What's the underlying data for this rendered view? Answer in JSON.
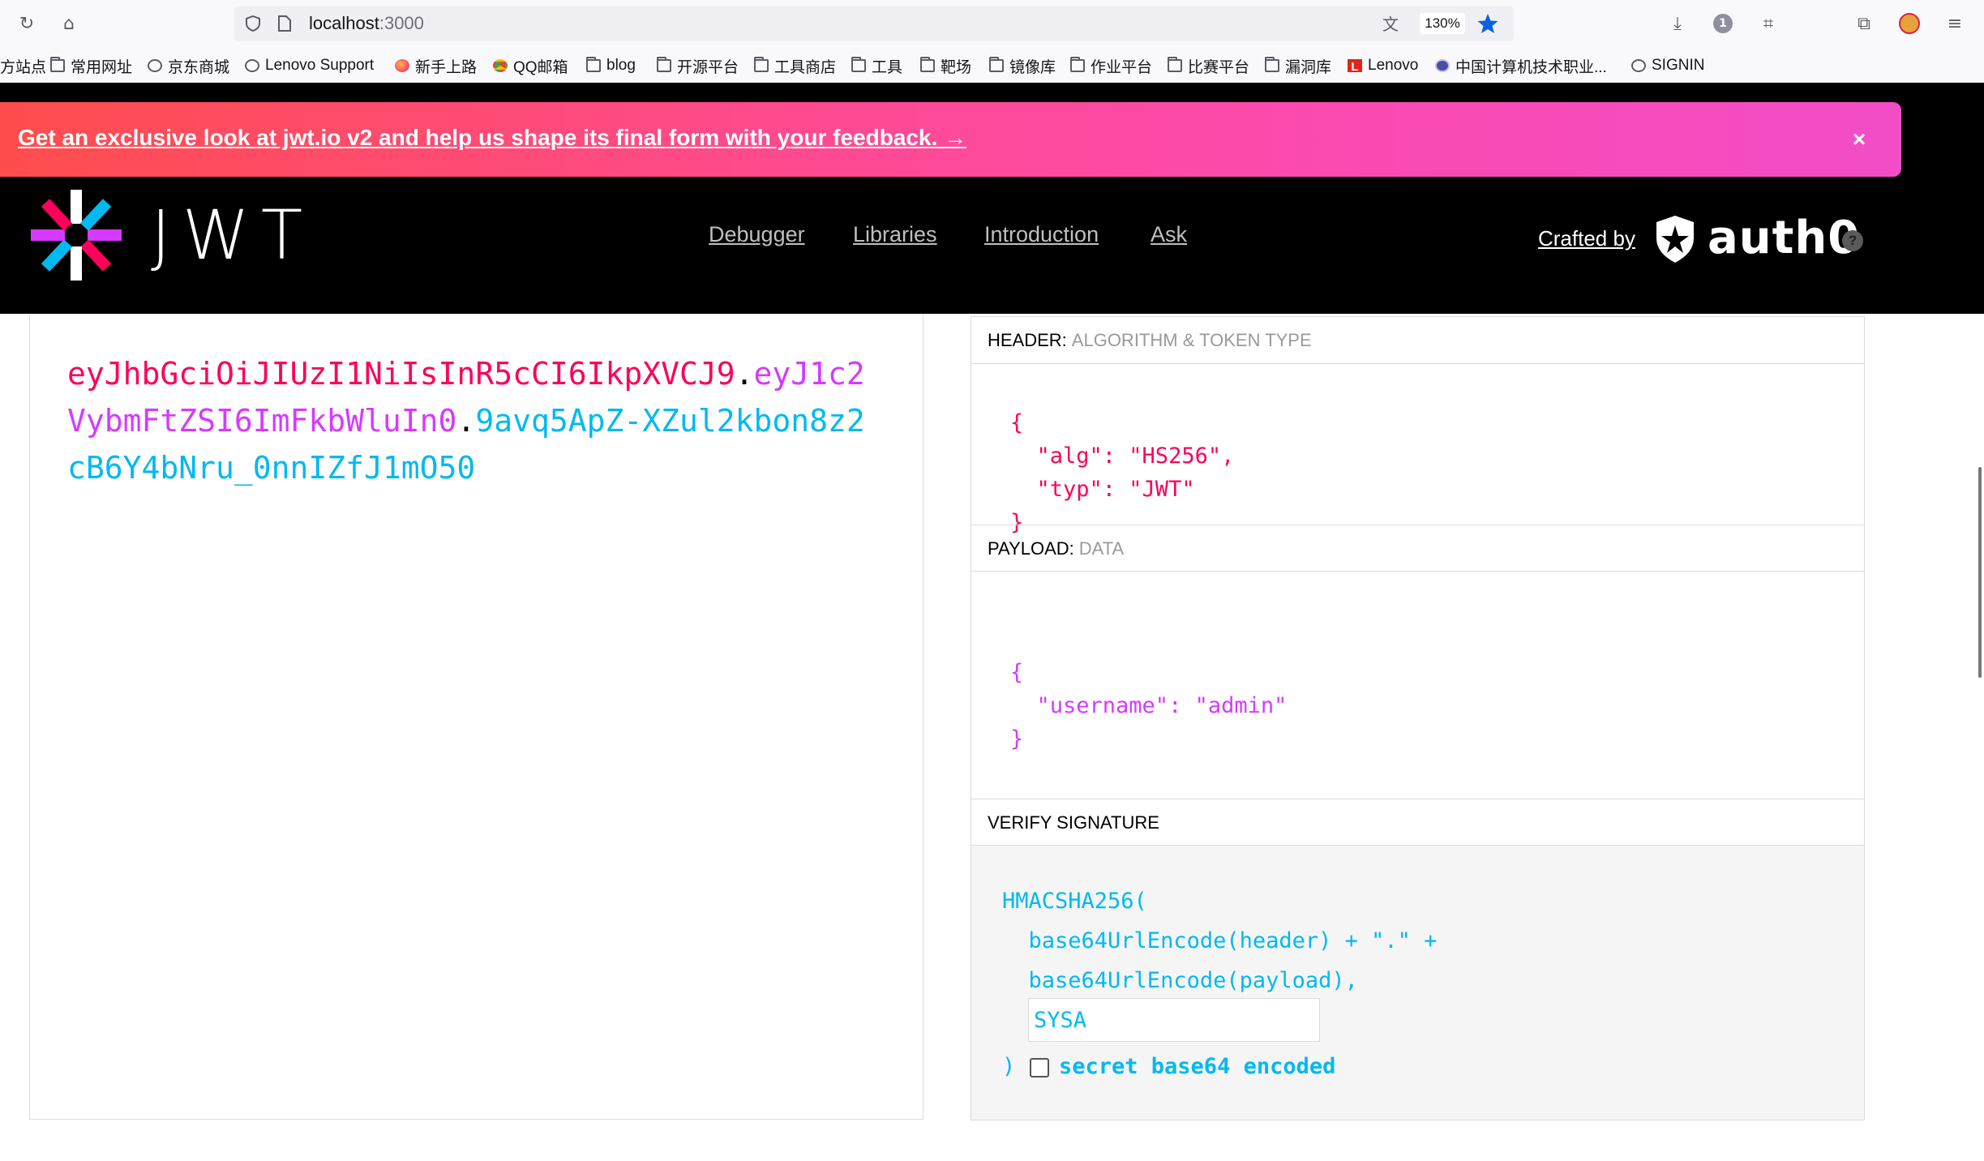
{
  "browser": {
    "url_host": "localhost",
    "url_port": ":3000",
    "zoom": "130%",
    "bookmarks": [
      {
        "label": "方站点",
        "icon": "none"
      },
      {
        "label": "常用网址",
        "icon": "folder"
      },
      {
        "label": "京东商城",
        "icon": "globe"
      },
      {
        "label": "Lenovo Support",
        "icon": "globe"
      },
      {
        "label": "新手上路",
        "icon": "firefox"
      },
      {
        "label": "QQ邮箱",
        "icon": "qq-mail"
      },
      {
        "label": "blog",
        "icon": "folder"
      },
      {
        "label": "开源平台",
        "icon": "folder"
      },
      {
        "label": "工具商店",
        "icon": "folder"
      },
      {
        "label": "工具",
        "icon": "folder"
      },
      {
        "label": "靶场",
        "icon": "folder"
      },
      {
        "label": "镜像库",
        "icon": "folder"
      },
      {
        "label": "作业平台",
        "icon": "folder"
      },
      {
        "label": "比赛平台",
        "icon": "folder"
      },
      {
        "label": "漏洞库",
        "icon": "folder"
      },
      {
        "label": "Lenovo",
        "icon": "lenovo"
      },
      {
        "label": "中国计算机技术职业...",
        "icon": "site"
      },
      {
        "label": "SIGNIN",
        "icon": "globe"
      }
    ],
    "badge_count": "1"
  },
  "banner": {
    "text": "Get an exclusive look at jwt.io v2 and help us shape its final form with your feedback.",
    "arrow": "→",
    "close": "×"
  },
  "site": {
    "logo_text": "JWT",
    "nav": [
      "Debugger",
      "Libraries",
      "Introduction",
      "Ask"
    ],
    "crafted_by": "Crafted by",
    "auth0": "auth0",
    "help": "?"
  },
  "encoded": {
    "header": "eyJhbGciOiJIUzI1NiIsInR5cCI6IkpXVCJ9",
    "payload": "eyJ1c2VybmFtZSI6ImFkbWluIn0",
    "signature": "9avq5ApZ-XZul2kbon8z2cB6Y4bNru_0nnIZfJ1mO50",
    "dot": "."
  },
  "decoded": {
    "header_title": "HEADER:",
    "header_sub": "ALGORITHM & TOKEN TYPE",
    "header_json": "{\n  \"alg\": \"HS256\",\n  \"typ\": \"JWT\"\n}",
    "payload_title": "PAYLOAD:",
    "payload_sub": "DATA",
    "payload_json": "{\n  \"username\": \"admin\"\n}",
    "verify_title": "VERIFY SIGNATURE",
    "verify_code": "HMACSHA256(\n  base64UrlEncode(header) + \".\" +\n  base64UrlEncode(payload),",
    "secret_value": "SYSA",
    "close_paren": ")",
    "b64_label": "secret base64 encoded"
  },
  "colors": {
    "header": "#fb015b",
    "payload": "#d63aff",
    "signature": "#00b9f1"
  }
}
